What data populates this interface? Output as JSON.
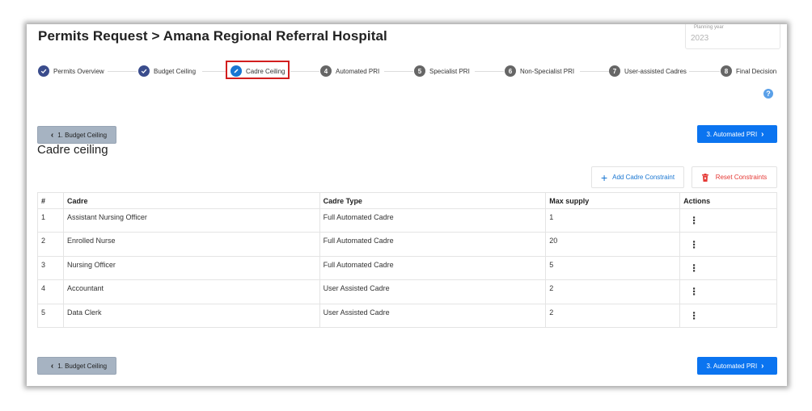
{
  "header": {
    "title": "Permits Request > Amana Regional Referral Hospital",
    "planning_year_label": "Planning year",
    "planning_year_value": "2023"
  },
  "stepper": {
    "steps": [
      {
        "number": "",
        "label": "Permits Overview",
        "status": "done"
      },
      {
        "number": "",
        "label": "Budget Ceiling",
        "status": "done"
      },
      {
        "number": "",
        "label": "Cadre Ceiling",
        "status": "active"
      },
      {
        "number": "4",
        "label": "Automated PRI",
        "status": "todo"
      },
      {
        "number": "5",
        "label": "Specialist PRI",
        "status": "todo"
      },
      {
        "number": "6",
        "label": "Non-Specialist PRI",
        "status": "todo"
      },
      {
        "number": "7",
        "label": "User-assisted Cadres",
        "status": "todo"
      },
      {
        "number": "8",
        "label": "Final Decision",
        "status": "todo"
      }
    ],
    "help_icon": "?"
  },
  "nav": {
    "back_label": "1. Budget Ceiling",
    "next_label": "3. Automated PRI"
  },
  "section": {
    "title": "Cadre ceiling",
    "add_label": "Add Cadre Constraint",
    "reset_label": "Reset Constraints"
  },
  "table": {
    "headers": [
      "#",
      "Cadre",
      "Cadre Type",
      "Max supply",
      "Actions"
    ],
    "rows": [
      {
        "num": "1",
        "cadre": "Assistant Nursing Officer",
        "type": "Full Automated Cadre",
        "max": "1"
      },
      {
        "num": "2",
        "cadre": "Enrolled Nurse",
        "type": "Full Automated Cadre",
        "max": "20"
      },
      {
        "num": "3",
        "cadre": "Nursing Officer",
        "type": "Full Automated Cadre",
        "max": "5"
      },
      {
        "num": "4",
        "cadre": "Accountant",
        "type": "User Assisted Cadre",
        "max": "2"
      },
      {
        "num": "5",
        "cadre": "Data Clerk",
        "type": "User Assisted Cadre",
        "max": "2"
      }
    ]
  },
  "colors": {
    "primary": "#0b74f0",
    "done_step": "#3a4c8c",
    "highlight_box": "#d21e1e",
    "danger": "#e53935"
  }
}
